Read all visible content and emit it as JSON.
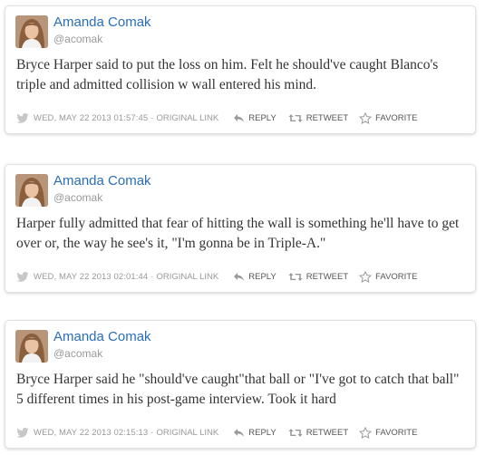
{
  "tweets": [
    {
      "author_name": "Amanda Comak",
      "author_handle": "@acomak",
      "text": "Bryce Harper said to put the loss on him. Felt he should've caught Blanco's triple and admitted collision w wall entered his mind.",
      "timestamp": "WED, MAY 22 2013 01:57:45",
      "separator": "·",
      "original_link_label": "ORIGINAL LINK",
      "reply_label": "REPLY",
      "retweet_label": "RETWEET",
      "favorite_label": "FAVORITE"
    },
    {
      "author_name": "Amanda Comak",
      "author_handle": "@acomak",
      "text": "Harper fully admitted that fear of hitting the wall is something he'll have to get over or, the way he see's it, \"I'm gonna be in Triple-A.\"",
      "timestamp": "WED, MAY 22 2013 02:01:44",
      "separator": "·",
      "original_link_label": "ORIGINAL LINK",
      "reply_label": "REPLY",
      "retweet_label": "RETWEET",
      "favorite_label": "FAVORITE"
    },
    {
      "author_name": "Amanda Comak",
      "author_handle": "@acomak",
      "text": "Bryce Harper said he \"should've caught\"that ball or \"I've got to catch that ball\" 5 different times in his post-game interview. Took it hard",
      "timestamp": "WED, MAY 22 2013 02:15:13",
      "separator": "·",
      "original_link_label": "ORIGINAL LINK",
      "reply_label": "REPLY",
      "retweet_label": "RETWEET",
      "favorite_label": "FAVORITE"
    }
  ],
  "colors": {
    "name": "#2a6eb7",
    "handle": "#999999",
    "text": "#333333",
    "meta": "#999999",
    "action": "#555555",
    "border": "#e1e1e1"
  },
  "icons": {
    "platform": "bird-icon",
    "reply": "reply-icon",
    "retweet": "retweet-icon",
    "favorite": "star-icon"
  }
}
